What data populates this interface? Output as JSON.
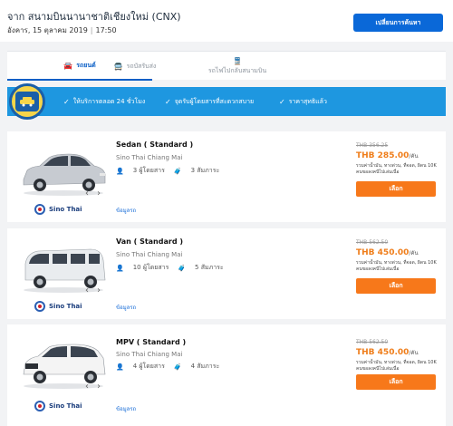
{
  "header": {
    "title": "จาก สนามบินนานาชาติเชียงใหม่ (CNX)",
    "date": "อังคาร, 15 ตุลาคม 2019",
    "time": "17:50",
    "change_button": "เปลี่ยนการค้นหา"
  },
  "tabs": [
    {
      "label": "รถยนต์",
      "icon": "car-icon",
      "active": true
    },
    {
      "label": "รถบัสรับส่ง",
      "icon": "bus-icon",
      "active": false
    },
    {
      "label": "รถไฟไปกลับสนามบิน",
      "icon": "train-icon",
      "active": false
    }
  ],
  "banner": {
    "features": [
      "ให้บริการตลอด 24 ชั่วโมง",
      "จุดรับผู้โดยสารที่สะดวกสบาย",
      "ราคาสุทธิแล้ว"
    ]
  },
  "colors": {
    "accent": "#0a68d8",
    "price": "#ef7d1a",
    "select": "#f7781a",
    "banner": "#1e97e0"
  },
  "cars": [
    {
      "name": "Sedan ( Standard )",
      "company": "Sino Thai Chiang Mai",
      "passengers": "3 ผู้โดยสาร",
      "luggage": "3 สัมภาระ",
      "price_old": "THB 356.25",
      "price_new": "THB 285.00",
      "price_unit": "/คัน",
      "note": "รวมค่าน้ำมัน, ทางด่วน, ที่จอด, ผิดน 10K คนขอลงคนีไปเล่นเนื่อ",
      "select_label": "เลือก",
      "provider": "Sino Thai",
      "info_label": "ข้อมูลรถ",
      "body_color": "#c7cbd1"
    },
    {
      "name": "Van ( Standard )",
      "company": "Sino Thai Chiang Mai",
      "passengers": "10 ผู้โดยสาร",
      "luggage": "5 สัมภาระ",
      "price_old": "THB 562.50",
      "price_new": "THB 450.00",
      "price_unit": "/คัน",
      "note": "รวมค่าน้ำมัน, ทางด่วน, ที่จอด, ผิดน 10K คนขอลงคนีไปเล่นเนื่อ",
      "select_label": "เลือก",
      "provider": "Sino Thai",
      "info_label": "ข้อมูลรถ",
      "body_color": "#e9ecef"
    },
    {
      "name": "MPV ( Standard )",
      "company": "Sino Thai Chiang Mai",
      "passengers": "4 ผู้โดยสาร",
      "luggage": "4 สัมภาระ",
      "price_old": "THB 562.50",
      "price_new": "THB 450.00",
      "price_unit": "/คัน",
      "note": "รวมค่าน้ำมัน, ทางด่วน, ที่จอด, ผิดน 10K คนขอลงคนีไปเล่นเนื่อ",
      "select_label": "เลือก",
      "provider": "Sino Thai",
      "info_label": "ข้อมูลรถ",
      "body_color": "#f4f4f4"
    }
  ]
}
